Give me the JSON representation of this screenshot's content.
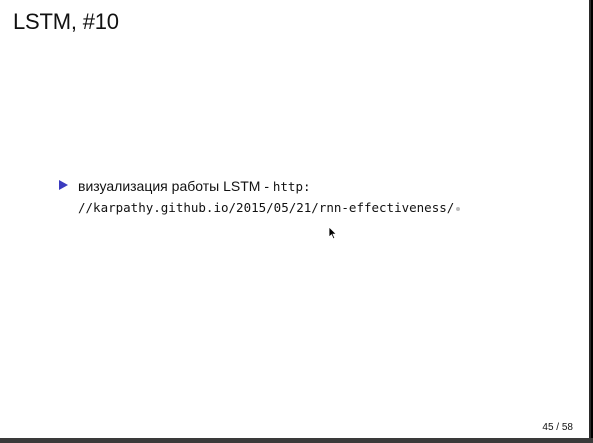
{
  "slide": {
    "title": "LSTM, #10",
    "bullets": [
      {
        "text": "визуализация работы LSTM - ",
        "link_line1": "http:",
        "link_line2": "//karpathy.github.io/2015/05/21/rnn-effectiveness/"
      }
    ],
    "page_number": "45 / 58"
  },
  "colors": {
    "bullet": "#3b3bbf",
    "text": "#111111",
    "background": "#ffffff"
  },
  "icons": {
    "bullet": "triangle-bullet-icon",
    "pointer": "mouse-cursor-icon"
  }
}
